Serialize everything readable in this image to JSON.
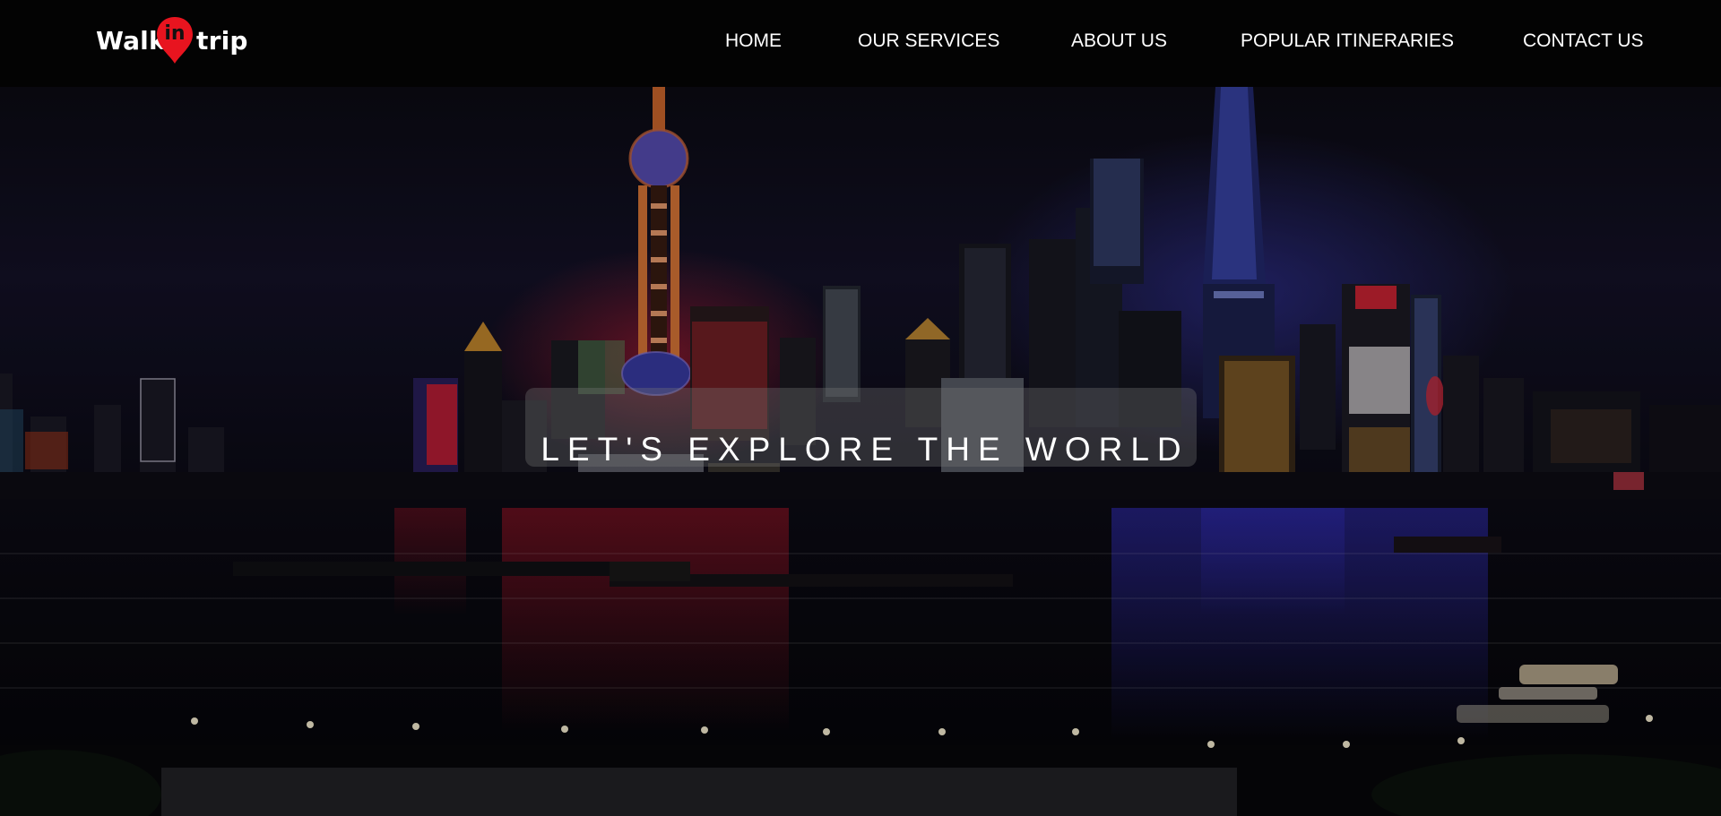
{
  "logo": {
    "word_left": "Walk",
    "word_middle": "in",
    "word_right": "trip",
    "pin_color": "#e8141f"
  },
  "nav": {
    "items": [
      {
        "label": "HOME"
      },
      {
        "label": "OUR SERVICES"
      },
      {
        "label": "ABOUT US"
      },
      {
        "label": "POPULAR ITINERARIES"
      },
      {
        "label": "CONTACT US"
      }
    ]
  },
  "hero": {
    "title": "LET'S EXPLORE THE WORLD",
    "image": "night-city-skyline-river"
  },
  "colors": {
    "header_bg": "#030303",
    "text": "#ffffff",
    "accent_red": "#e8141f"
  }
}
